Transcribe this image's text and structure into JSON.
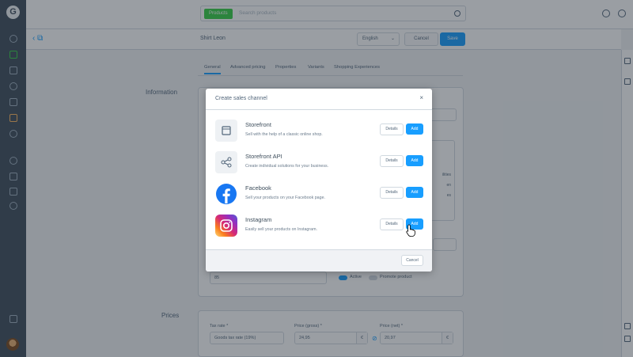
{
  "app": {
    "product_title": "Shirt Leon",
    "search": {
      "scope_label": "Products",
      "placeholder": "Search products"
    },
    "language": "English",
    "cancel_label": "Cancel",
    "save_label": "Save"
  },
  "tabs": [
    "General",
    "Advanced pricing",
    "Properties",
    "Variants",
    "Shopping Experiences"
  ],
  "sections": {
    "information": "Information",
    "prices": "Prices"
  },
  "background_form": {
    "stock_value": "85",
    "active_label": "Active",
    "promote_label": "Promote product",
    "tax_rate_label": "Tax rate *",
    "tax_rate_value": "Goods tax rate (19%)",
    "price_gross_label": "Price (gross) *",
    "price_gross_value": "24,95",
    "price_net_label": "Price (net) *",
    "price_net_value": "20,97",
    "currency_symbol": "€",
    "editor_snippets": [
      "ilities",
      "en",
      "es"
    ]
  },
  "modal": {
    "title": "Create sales channel",
    "close_glyph": "×",
    "channels": [
      {
        "name": "Storefront",
        "description": "Sell with the help of a classic online shop.",
        "details_label": "Details",
        "add_label": "Add",
        "icon": "storefront-icon"
      },
      {
        "name": "Storefront API",
        "description": "Create individual solutions for your business.",
        "details_label": "Details",
        "add_label": "Add",
        "icon": "share-nodes-icon"
      },
      {
        "name": "Facebook",
        "description": "Sell your products on your Facebook page.",
        "details_label": "Details",
        "add_label": "Add",
        "icon": "facebook-icon"
      },
      {
        "name": "Instagram",
        "description": "Easily sell your products on Instagram.",
        "details_label": "Details",
        "add_label": "Add",
        "icon": "instagram-icon"
      }
    ],
    "cancel_label": "Cancel"
  },
  "colors": {
    "accent": "#189eff",
    "green": "#37d046",
    "sidebar": "#3e4e5c"
  }
}
